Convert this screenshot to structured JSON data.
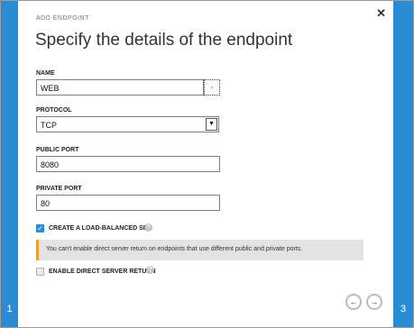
{
  "dialog": {
    "kicker": "ADD ENDPOINT",
    "title": "Specify the details of the endpoint",
    "close_glyph": "✕"
  },
  "fields": {
    "name": {
      "label": "NAME",
      "value": "WEB"
    },
    "protocol": {
      "label": "PROTOCOL",
      "value": "TCP"
    },
    "public_port": {
      "label": "PUBLIC PORT",
      "value": "8080"
    },
    "private_port": {
      "label": "PRIVATE PORT",
      "value": "80"
    }
  },
  "options": {
    "load_balanced": {
      "label": "CREATE A LOAD-BALANCED SET",
      "checked": true
    },
    "direct_return": {
      "label": "ENABLE DIRECT SERVER RETURN",
      "checked": false
    }
  },
  "notice": "You can't enable direct server return on endpoints that use different public and private ports.",
  "steps": {
    "left": "1",
    "right": "3"
  },
  "icons": {
    "close": "close-icon",
    "back": "arrow-left-icon",
    "next": "arrow-right-icon",
    "help": "question-icon",
    "dropdown": "chevron-down-icon"
  },
  "colors": {
    "accent": "#2a8dd4",
    "warning": "#f0a030"
  }
}
